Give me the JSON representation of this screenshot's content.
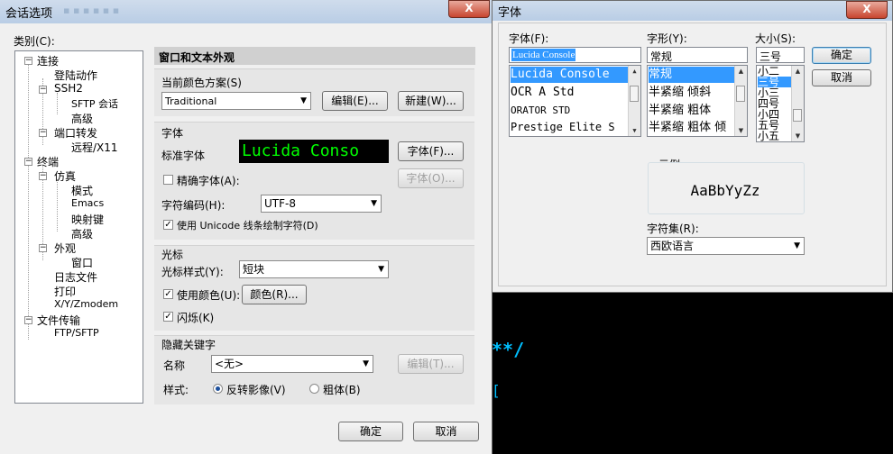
{
  "session_dialog": {
    "title": "会话选项",
    "close_label": "X",
    "category_label": "类别(C):",
    "tree": [
      {
        "label": "连接",
        "expander": "−"
      },
      {
        "label": "登陆动作"
      },
      {
        "label": "SSH2",
        "expander": "−"
      },
      {
        "label": "SFTP 会话"
      },
      {
        "label": "高级"
      },
      {
        "label": "端口转发",
        "expander": "−"
      },
      {
        "label": "远程/X11"
      },
      {
        "label": "终端",
        "expander": "−"
      },
      {
        "label": "仿真",
        "expander": "−"
      },
      {
        "label": "模式"
      },
      {
        "label": "Emacs"
      },
      {
        "label": "映射键"
      },
      {
        "label": "高级"
      },
      {
        "label": "外观",
        "expander": "−"
      },
      {
        "label": "窗口"
      },
      {
        "label": "日志文件"
      },
      {
        "label": "打印"
      },
      {
        "label": "X/Y/Zmodem"
      },
      {
        "label": "文件传输",
        "expander": "−"
      },
      {
        "label": "FTP/SFTP"
      }
    ],
    "panel_title": "窗口和文本外观",
    "color_scheme_label": "当前颜色方案(S)",
    "color_scheme_value": "Traditional",
    "edit_button": "编辑(E)...",
    "new_button": "新建(W)...",
    "font_section": "字体",
    "standard_font_label": "标准字体",
    "font_preview": "Lucida Conso",
    "font_button": "字体(F)...",
    "precise_font_label": "精确字体(A):",
    "precise_font_button": "字体(O)...",
    "encoding_label": "字符编码(H):",
    "encoding_value": "UTF-8",
    "unicode_label": "使用 Unicode 线条绘制字符(D)",
    "cursor_section": "光标",
    "cursor_style_label": "光标样式(Y):",
    "cursor_style_value": "短块",
    "use_color_label": "使用颜色(U):",
    "color_button": "颜色(R)...",
    "blink_label": "闪烁(K)",
    "hidden_section": "隐藏关键字",
    "name_label": "名称",
    "name_value": "<无>",
    "name_edit_button": "编辑(T)...",
    "style_label": "样式:",
    "reverse_label": "反转影像(V)",
    "bold_label": "粗体(B)",
    "ok_button": "确定",
    "cancel_button": "取消"
  },
  "font_dialog": {
    "title": "字体",
    "close_label": "X",
    "font_label": "字体(F):",
    "font_input": "Lucida Console",
    "fonts": [
      "Lucida Console",
      "OCR A Std",
      "ORATOR STD",
      "Prestige Elite S"
    ],
    "style_label": "字形(Y):",
    "style_input": "常规",
    "styles": [
      "常规",
      "半紧缩 倾斜",
      "半紧缩 粗体",
      "半紧缩 粗体 倾"
    ],
    "size_label": "大小(S):",
    "size_input": "三号",
    "sizes": [
      "小二",
      "三号",
      "小三",
      "四号",
      "小四",
      "五号",
      "小五"
    ],
    "ok_button": "确定",
    "cancel_button": "取消",
    "sample_label": "示例",
    "sample_text": "AaBbYyZz",
    "charset_label": "字符集(R):",
    "charset_value": "西欧语言"
  },
  "terminal": {
    "text1": "**/",
    "text2": "["
  },
  "colors": {
    "accent": "#3399ff",
    "terminal_green": "#00ff00",
    "terminal_text": "#00bfff"
  }
}
